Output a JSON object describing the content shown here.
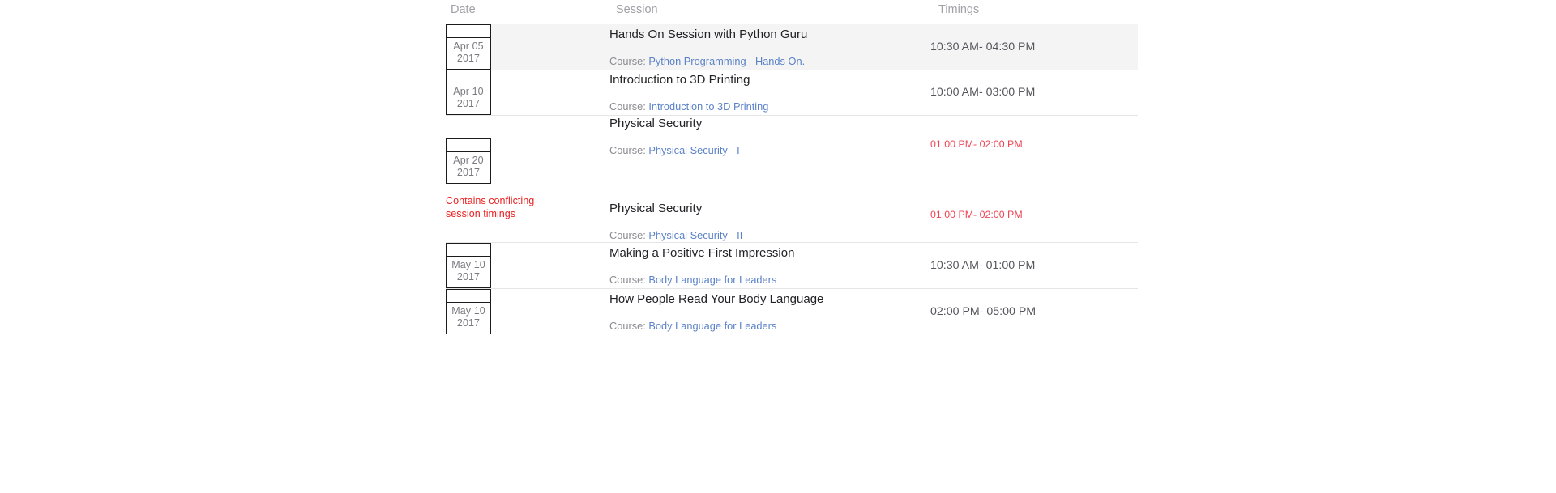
{
  "table": {
    "headers": {
      "date": "Date",
      "session": "Session",
      "timings": "Timings"
    },
    "course_prefix": "Course:",
    "conflict_note": "Contains conflicting session timings",
    "colors": {
      "link": "#5b82c8",
      "conflict": "#ee2222",
      "conflict_timing": "#ee4455",
      "header_text": "#a0a0a6",
      "title_text": "#222226",
      "muted_text": "#8a8a90",
      "striped_row": "#f4f4f4",
      "row_divider": "#e6e6e6",
      "badge_border": "#1b1b1b"
    },
    "rows": [
      {
        "date": {
          "day": "Apr 05",
          "year": "2017"
        },
        "conflict": false,
        "sessions": [
          {
            "title": "Hands On Session with Python Guru",
            "course_prefix": "Course:",
            "course": "Python Programming - Hands On.",
            "timing": "10:30 AM- 04:30 PM",
            "timing_conflict": false
          }
        ]
      },
      {
        "date": {
          "day": "Apr 10",
          "year": "2017"
        },
        "conflict": false,
        "sessions": [
          {
            "title": "Introduction to 3D Printing",
            "course_prefix": "Course:",
            "course": "Introduction to 3D Printing",
            "timing": "10:00 AM- 03:00 PM",
            "timing_conflict": false
          }
        ]
      },
      {
        "date": {
          "day": "Apr 20",
          "year": "2017"
        },
        "conflict": true,
        "conflict_note": "Contains conflicting session timings",
        "sessions": [
          {
            "title": "Physical Security",
            "course_prefix": "Course:",
            "course": "Physical Security - I",
            "timing": "01:00 PM- 02:00 PM",
            "timing_conflict": true
          },
          {
            "title": "Physical Security",
            "course_prefix": "Course:",
            "course": "Physical Security - II",
            "timing": "01:00 PM- 02:00 PM",
            "timing_conflict": true
          }
        ]
      },
      {
        "date": {
          "day": "May 10",
          "year": "2017"
        },
        "conflict": false,
        "sessions": [
          {
            "title": "Making a Positive First Impression",
            "course_prefix": "Course:",
            "course": "Body Language for Leaders",
            "timing": "10:30 AM- 01:00 PM",
            "timing_conflict": false
          }
        ]
      },
      {
        "date": {
          "day": "May 10",
          "year": "2017"
        },
        "conflict": false,
        "sessions": [
          {
            "title": "How People Read Your Body Language",
            "course_prefix": "Course:",
            "course": "Body Language for Leaders",
            "timing": "02:00 PM- 05:00 PM",
            "timing_conflict": false
          }
        ]
      }
    ]
  }
}
